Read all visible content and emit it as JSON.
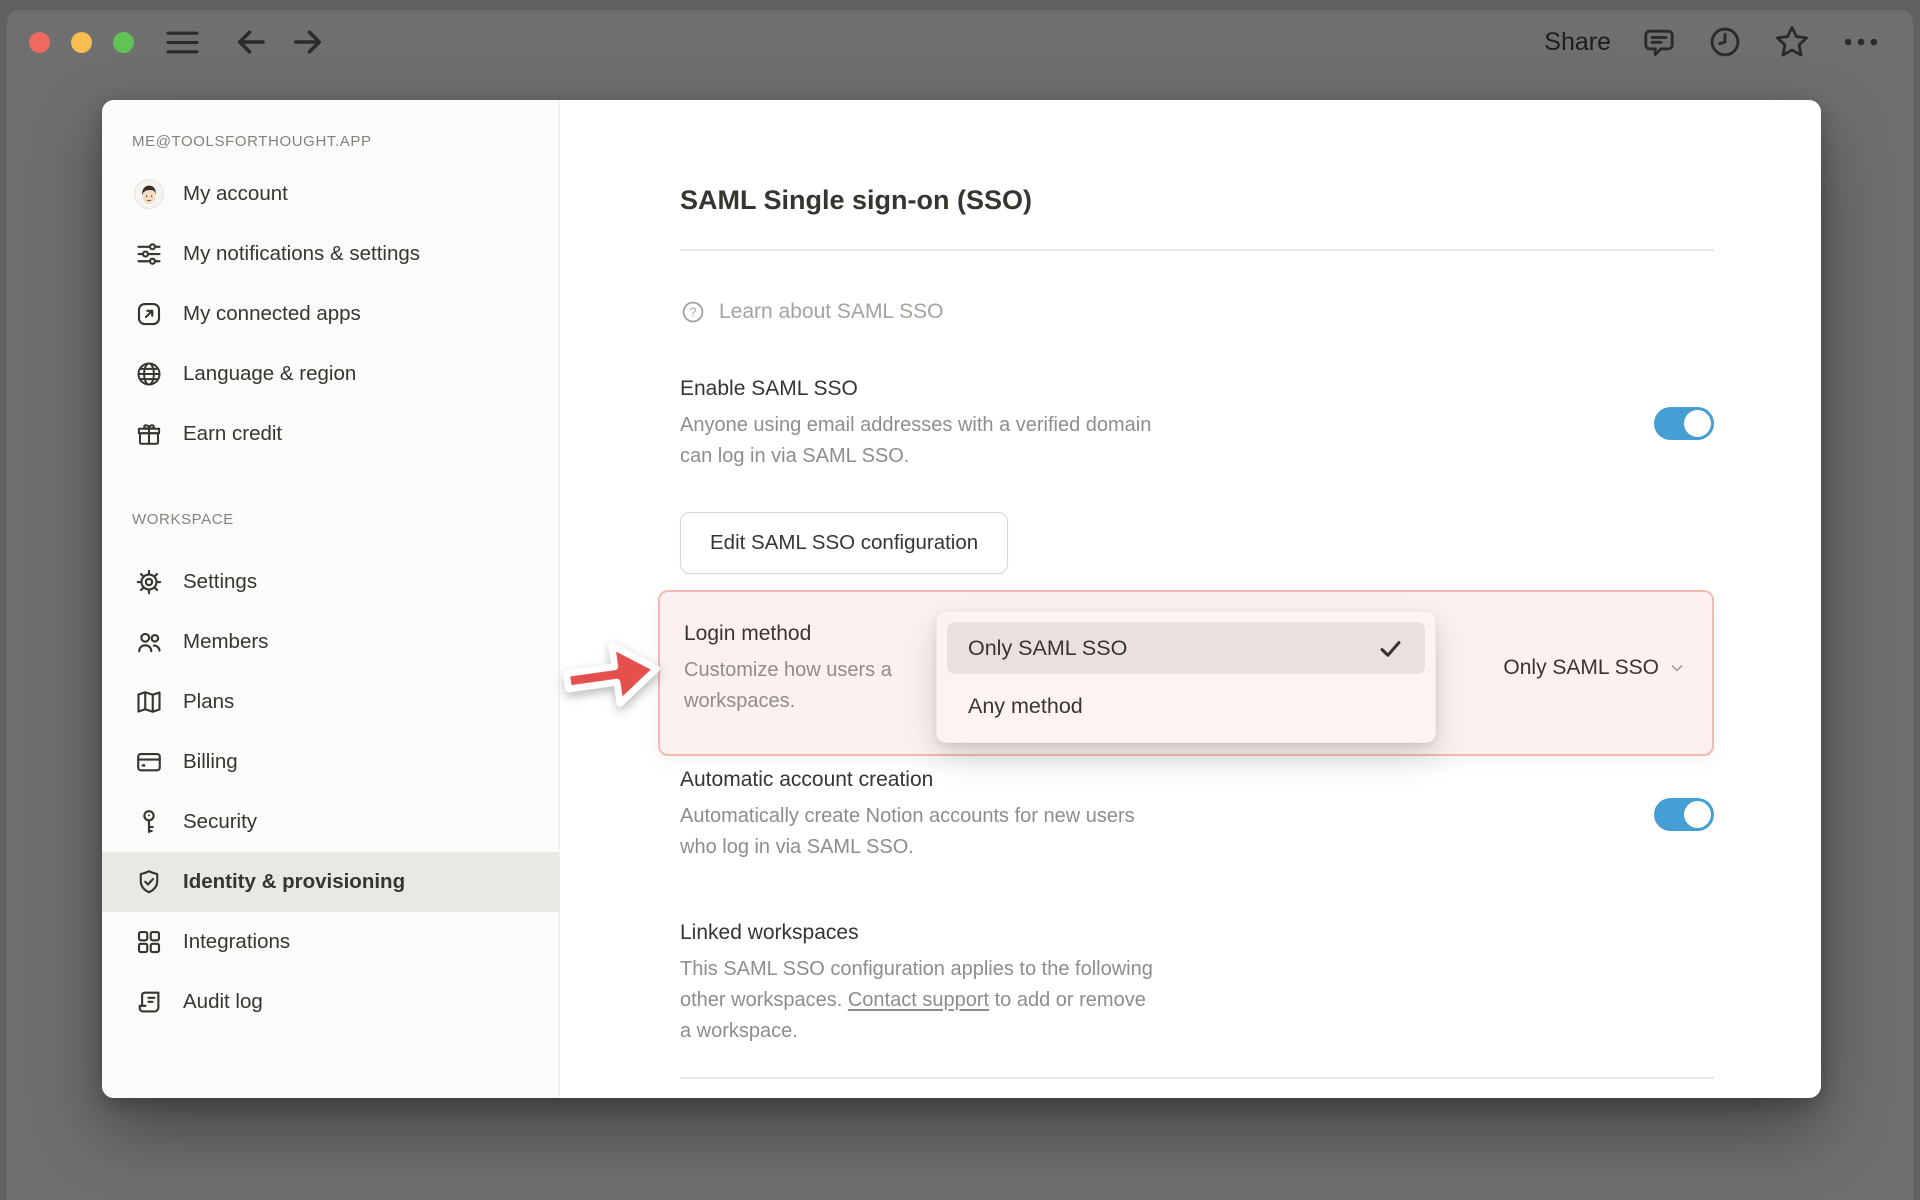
{
  "chrome": {
    "share_label": "Share",
    "icons": [
      "hamburger-icon",
      "back-icon",
      "forward-icon",
      "comment-icon",
      "clock-icon",
      "star-icon",
      "ellipsis-icon"
    ],
    "window_controls": [
      "close",
      "minimize",
      "zoom"
    ]
  },
  "sidebar": {
    "account_header": "ME@TOOLSFORTHOUGHT.APP",
    "account_items": [
      {
        "slug": "my-account",
        "label": "My account",
        "icon": "avatar"
      },
      {
        "slug": "my-notifications",
        "label": "My notifications & settings",
        "icon": "sliders-icon"
      },
      {
        "slug": "my-connected-apps",
        "label": "My connected apps",
        "icon": "arrow-up-right-square-icon"
      },
      {
        "slug": "language-region",
        "label": "Language & region",
        "icon": "globe-icon"
      },
      {
        "slug": "earn-credit",
        "label": "Earn credit",
        "icon": "gift-icon"
      }
    ],
    "workspace_header": "WORKSPACE",
    "workspace_items": [
      {
        "slug": "settings",
        "label": "Settings",
        "icon": "gear-icon"
      },
      {
        "slug": "members",
        "label": "Members",
        "icon": "people-icon"
      },
      {
        "slug": "plans",
        "label": "Plans",
        "icon": "map-icon"
      },
      {
        "slug": "billing",
        "label": "Billing",
        "icon": "credit-card-icon"
      },
      {
        "slug": "security",
        "label": "Security",
        "icon": "key-icon"
      },
      {
        "slug": "identity-provisioning",
        "label": "Identity & provisioning",
        "icon": "shield-check-icon",
        "selected": true
      },
      {
        "slug": "integrations",
        "label": "Integrations",
        "icon": "grid-icon"
      },
      {
        "slug": "audit-log",
        "label": "Audit log",
        "icon": "scroll-icon"
      }
    ]
  },
  "main": {
    "title": "SAML Single sign-on (SSO)",
    "learn_label": "Learn about SAML SSO",
    "enable": {
      "heading": "Enable SAML SSO",
      "desc_line1": "Anyone using email addresses with a verified domain",
      "desc_line2": "can log in via SAML SSO.",
      "enabled": true
    },
    "edit_button_label": "Edit SAML SSO configuration",
    "login_method": {
      "heading": "Login method",
      "desc_line1": "Customize how users a",
      "desc_line2": "workspaces.",
      "selected_value": "Only SAML SSO",
      "options": [
        {
          "label": "Only SAML SSO",
          "checked": true
        },
        {
          "label": "Any method",
          "checked": false
        }
      ]
    },
    "auto_account": {
      "heading": "Automatic account creation",
      "desc_line1": "Automatically create Notion accounts for new users",
      "desc_line2": "who log in via SAML SSO.",
      "enabled": true
    },
    "linked": {
      "heading": "Linked workspaces",
      "desc_line1": "This SAML SSO configuration applies to the following",
      "desc_line2_pre": "other workspaces. ",
      "link_label": "Contact support",
      "desc_line2_post": " to add or remove",
      "desc_line3": "a workspace."
    }
  },
  "colors": {
    "toggle_blue": "#459fd4",
    "arrow_red": "#e4514d",
    "highlight_bg": "#fcf1f0",
    "highlight_border": "#f3b9b3",
    "option_selected_bg": "#eae0e0",
    "traffic_red": "#ee6a5e",
    "traffic_yellow": "#f6bd50",
    "traffic_green": "#61c355"
  }
}
